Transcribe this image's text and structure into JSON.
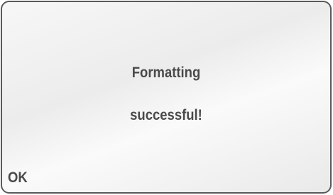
{
  "dialog": {
    "message_line1": "Formatting",
    "message_line2": "successful!",
    "softkey_left_label": "OK"
  },
  "colors": {
    "text": "#4a4a4a",
    "border": "#5a5a5a",
    "background": "#efefef"
  }
}
